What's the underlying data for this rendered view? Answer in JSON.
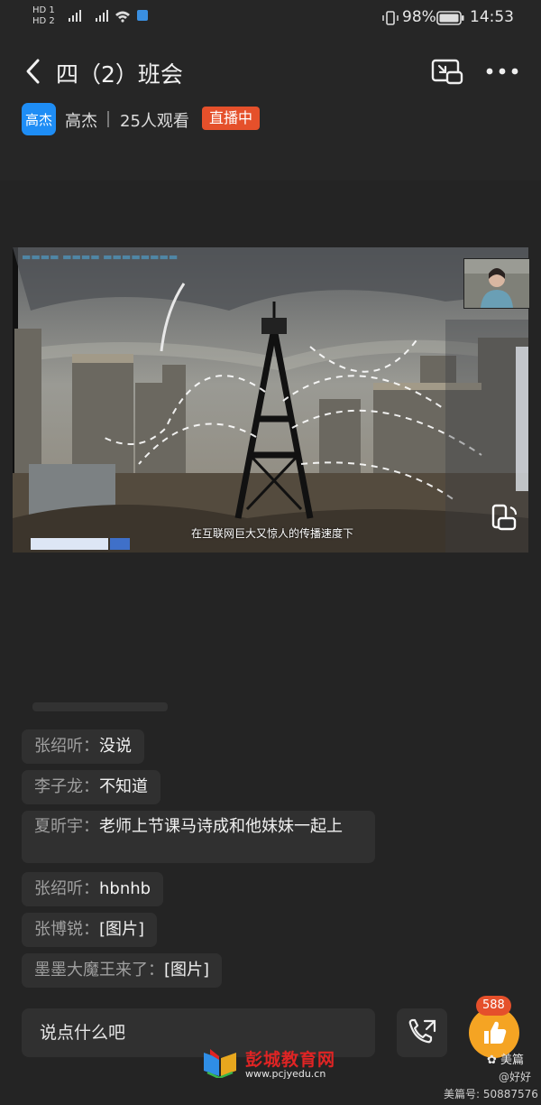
{
  "status_bar": {
    "sim1": "HD 1",
    "sim2": "HD 2",
    "battery": "98%",
    "time": "14:53"
  },
  "header": {
    "title": "四（2）班会",
    "host_avatar_text": "高杰",
    "host_name": "高杰",
    "viewers": "25人观看",
    "live_badge": "直播中"
  },
  "video": {
    "subtitle": "在互联网巨大又惊人的传播速度下"
  },
  "chat": [
    {
      "name": "张绍听：",
      "text": "没说"
    },
    {
      "name": "李子龙：",
      "text": "不知道"
    },
    {
      "name": "夏昕宇：",
      "text": "老师上节课马诗成和他妹妹一起上"
    },
    {
      "name": "张绍听：",
      "text": "hbnhb"
    },
    {
      "name": "张博锐：",
      "text": "[图片]"
    },
    {
      "name": "墨墨大魔王来了：",
      "text": "[图片]"
    }
  ],
  "input": {
    "placeholder": "说点什么吧"
  },
  "like": {
    "count": "588"
  },
  "watermark": {
    "brand": "美篇",
    "user": "@好好",
    "id": "美篇号: 50887576",
    "site_name": "彭城教育网",
    "site_url": "www.pcjyedu.cn"
  },
  "icons": [
    "back-icon",
    "pip-icon",
    "more-icon",
    "rotate-icon",
    "call-icon",
    "thumbs-up-icon"
  ]
}
